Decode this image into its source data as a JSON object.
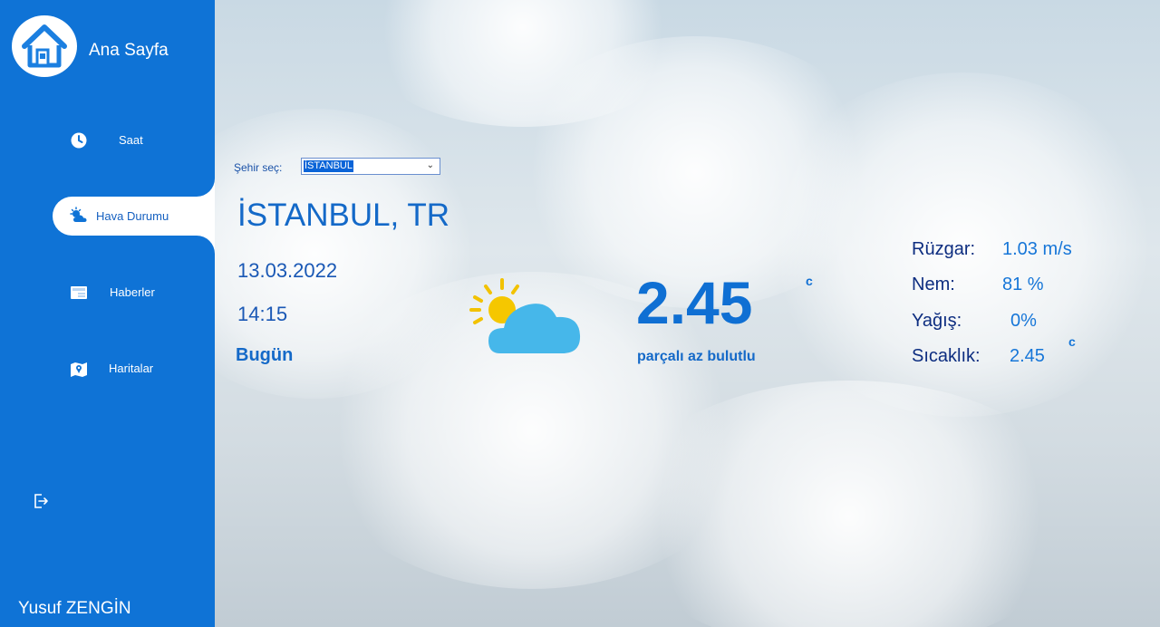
{
  "sidebar": {
    "title": "Ana Sayfa",
    "items": [
      {
        "label": "Saat",
        "icon": "clock-icon"
      },
      {
        "label": "Hava Durumu",
        "icon": "weather-icon",
        "active": true
      },
      {
        "label": "Haberler",
        "icon": "newspaper-icon"
      },
      {
        "label": "Haritalar",
        "icon": "map-icon"
      }
    ],
    "user": "Yusuf ZENGİN"
  },
  "city_select": {
    "label": "Şehir seç:",
    "value": "İSTANBUL"
  },
  "weather": {
    "city": "İSTANBUL, TR",
    "date": "13.03.2022",
    "time": "14:15",
    "day": "Bugün",
    "temp": "2.45",
    "temp_unit": "c",
    "description": "parçalı az bulutlu",
    "stats": [
      {
        "label": "Rüzgar:",
        "value": "1.03 m/s"
      },
      {
        "label": "Nem:",
        "value": "81 %"
      },
      {
        "label": "Yağış:",
        "value": "0%"
      },
      {
        "label": "Sıcaklık:",
        "value": "2.45"
      }
    ],
    "stat_temp_unit": "c"
  },
  "colors": {
    "sidebar": "#0f73d6",
    "accent": "#1469c8",
    "stat_label": "#0d2d80"
  }
}
